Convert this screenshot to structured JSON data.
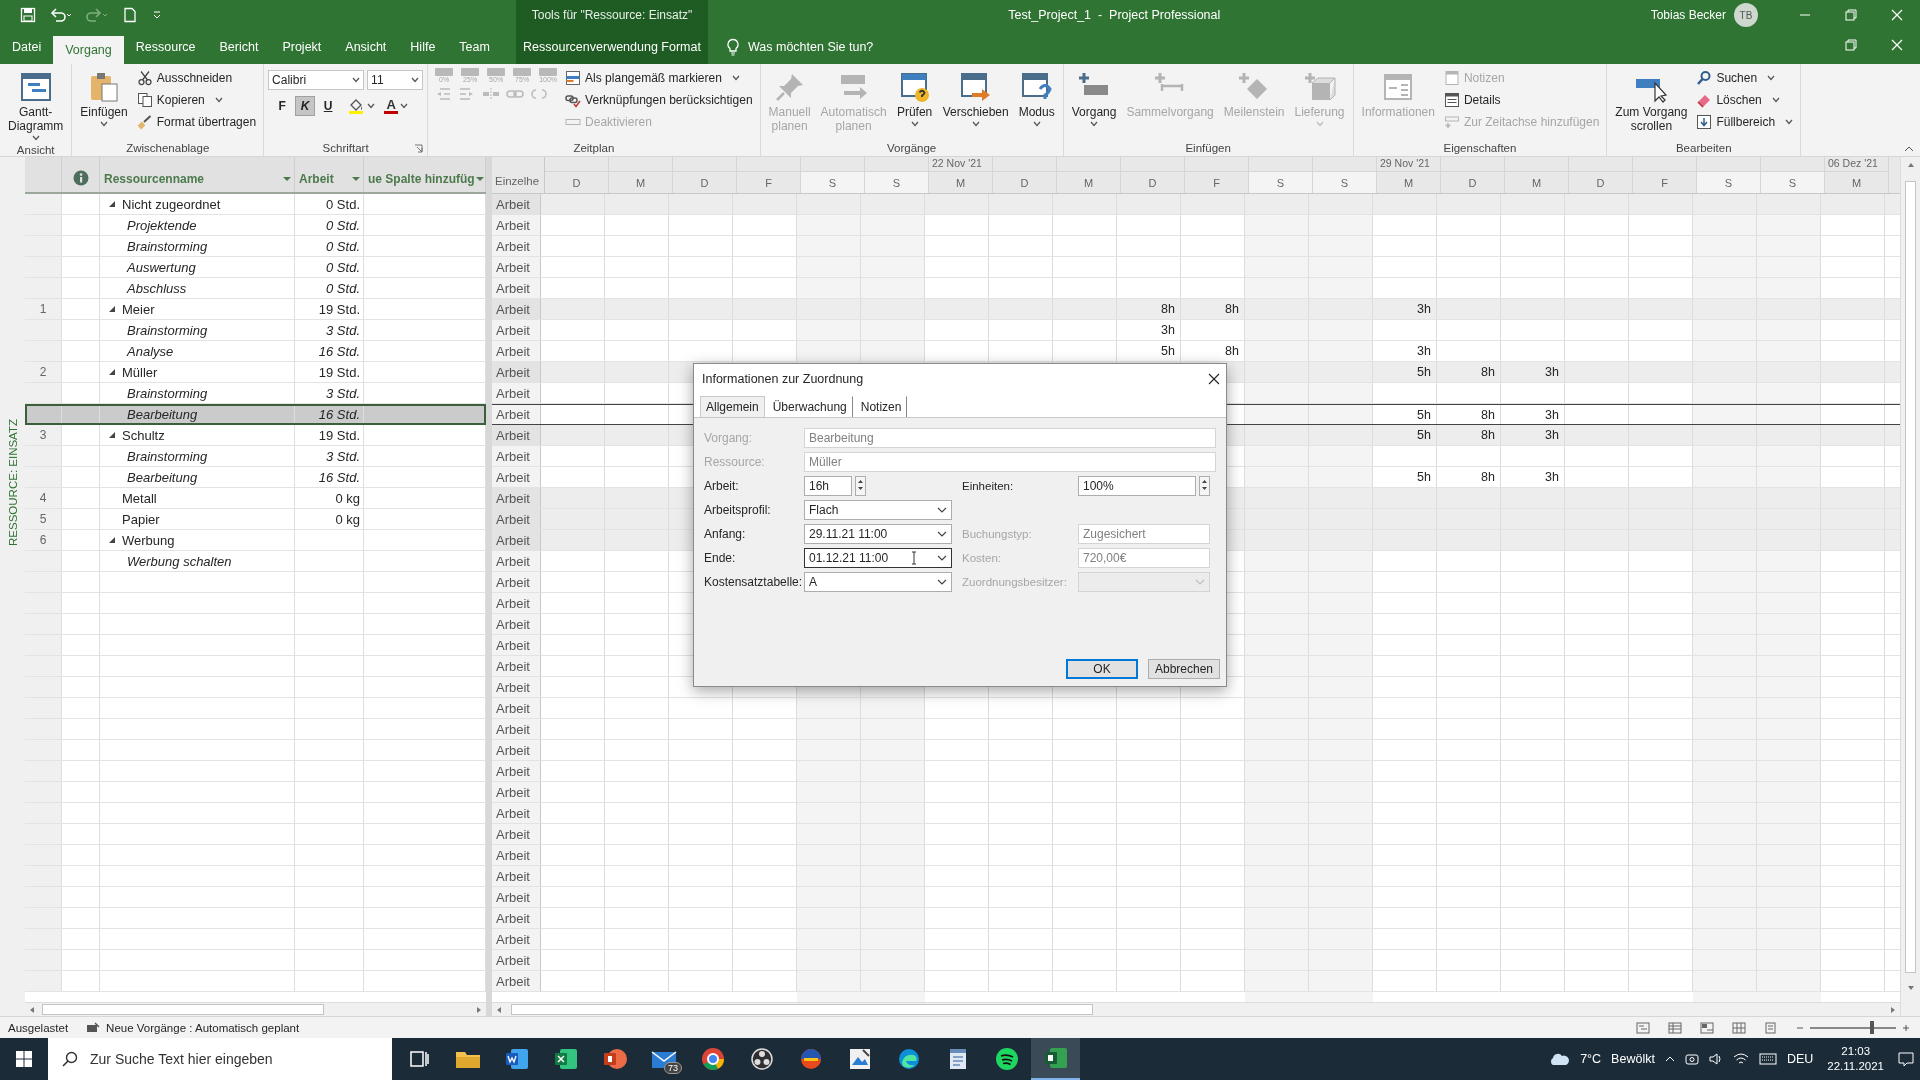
{
  "title_bar": {
    "contextual": "Tools für \"Ressource: Einsatz\"",
    "title": "Test_Project_1  -  Project Professional",
    "user": "Tobias Becker",
    "initials": "TB"
  },
  "tabs": [
    {
      "label": "Datei",
      "selected": false
    },
    {
      "label": "Vorgang",
      "selected": true
    },
    {
      "label": "Ressource",
      "selected": false
    },
    {
      "label": "Bericht",
      "selected": false
    },
    {
      "label": "Projekt",
      "selected": false
    },
    {
      "label": "Ansicht",
      "selected": false
    },
    {
      "label": "Hilfe",
      "selected": false
    },
    {
      "label": "Team",
      "selected": false
    }
  ],
  "contextual_tab": {
    "label": "Ressourcenverwendung Format",
    "selected": false
  },
  "tell_me": {
    "placeholder": "Was möchten Sie tun?"
  },
  "ribbon": [
    {
      "label": "Ansicht",
      "items": [
        {
          "kind": "large",
          "label": "Gantt-\nDiagramm",
          "dropdown": true,
          "disabled": false
        }
      ]
    },
    {
      "label": "Zwischenablage",
      "items": [
        {
          "kind": "large",
          "label": "Einfügen",
          "dropdown": true,
          "disabled": false
        },
        {
          "kind": "small",
          "label": "Ausschneiden",
          "dropdown": false,
          "disabled": false
        },
        {
          "kind": "small",
          "label": "Kopieren",
          "dropdown": true,
          "disabled": false
        },
        {
          "kind": "small",
          "label": "Format übertragen",
          "dropdown": false,
          "disabled": false
        }
      ]
    },
    {
      "label": "Schriftart",
      "items": [
        {
          "kind": "font",
          "font": "Calibri",
          "size": "11",
          "styles": [
            {
              "label": "F",
              "selected": false
            },
            {
              "label": "K",
              "selected": true
            },
            {
              "label": "U",
              "selected": false
            }
          ],
          "font_color": "A"
        }
      ]
    },
    {
      "label": "Zeitplan",
      "items": [
        {
          "kind": "percent",
          "labels": [
            "0%",
            "25%",
            "50%",
            "75%",
            "100%"
          ]
        },
        {
          "kind": "small",
          "label": "Als plangemäß markieren",
          "dropdown": true,
          "disabled": false
        },
        {
          "kind": "small",
          "label": "Verknüpfungen berücksichtigen",
          "dropdown": false,
          "disabled": false
        },
        {
          "kind": "small",
          "label": "Deaktivieren",
          "dropdown": false,
          "disabled": true
        }
      ]
    },
    {
      "label": "Vorgänge",
      "items": [
        {
          "kind": "large",
          "label": "Manuell\nplanen",
          "dropdown": false,
          "disabled": true
        },
        {
          "kind": "large",
          "label": "Automatisch\nplanen",
          "dropdown": false,
          "disabled": true
        },
        {
          "kind": "large",
          "label": "Prüfen",
          "dropdown": true,
          "disabled": false
        },
        {
          "kind": "large",
          "label": "Verschieben",
          "dropdown": true,
          "disabled": false
        },
        {
          "kind": "large",
          "label": "Modus",
          "dropdown": true,
          "disabled": false
        }
      ]
    },
    {
      "label": "Einfügen",
      "items": [
        {
          "kind": "large",
          "label": "Vorgang",
          "dropdown": true,
          "disabled": false
        },
        {
          "kind": "large",
          "label": "Sammelvorgang",
          "dropdown": false,
          "disabled": true
        },
        {
          "kind": "large",
          "label": "Meilenstein",
          "dropdown": false,
          "disabled": true
        },
        {
          "kind": "large",
          "label": "Lieferung",
          "dropdown": true,
          "disabled": true
        }
      ]
    },
    {
      "label": "Eigenschaften",
      "items": [
        {
          "kind": "large",
          "label": "Informationen",
          "dropdown": false,
          "disabled": true
        },
        {
          "kind": "small",
          "label": "Notizen",
          "dropdown": false,
          "disabled": true
        },
        {
          "kind": "small",
          "label": "Details",
          "dropdown": false,
          "disabled": false
        },
        {
          "kind": "small",
          "label": "Zur Zeitachse hinzufügen",
          "dropdown": false,
          "disabled": true
        }
      ]
    },
    {
      "label": "Bearbeiten",
      "items": [
        {
          "kind": "large",
          "label": "Zum Vorgang\nscrollen",
          "dropdown": false,
          "disabled": false
        },
        {
          "kind": "small",
          "label": "Suchen",
          "dropdown": true,
          "disabled": false
        },
        {
          "kind": "small",
          "label": "Löschen",
          "dropdown": true,
          "disabled": false
        },
        {
          "kind": "small",
          "label": "Füllbereich",
          "dropdown": true,
          "disabled": false
        }
      ]
    }
  ],
  "view_label": "RESSOURCE: EINSATZ",
  "table": {
    "columns": [
      "Ressourcenname",
      "Arbeit",
      "ue Spalte hinzufüg"
    ],
    "rows": [
      {
        "name": "Nicht zugeordnet",
        "work": "0 Std.",
        "detail": "Arbeit",
        "expanded": true,
        "selected": false,
        "children": [
          {
            "name": "Projektende",
            "work": "0 Std.",
            "detail": "Arbeit",
            "selected": false
          },
          {
            "name": "Brainstorming",
            "work": "0 Std.",
            "detail": "Arbeit",
            "selected": false
          },
          {
            "name": "Auswertung",
            "work": "0 Std.",
            "detail": "Arbeit",
            "selected": false
          },
          {
            "name": "Abschluss",
            "work": "0 Std.",
            "detail": "Arbeit",
            "selected": false
          }
        ]
      },
      {
        "id": "1",
        "name": "Meier",
        "work": "19 Std.",
        "detail": "Arbeit",
        "expanded": true,
        "selected": false,
        "timephased": {
          "10": "8h",
          "11": "8h",
          "14": "3h"
        },
        "children": [
          {
            "name": "Brainstorming",
            "work": "3 Std.",
            "detail": "Arbeit",
            "selected": false,
            "timephased": {
              "10": "3h"
            }
          },
          {
            "name": "Analyse",
            "work": "16 Std.",
            "detail": "Arbeit",
            "selected": false,
            "timephased": {
              "10": "5h",
              "11": "8h",
              "14": "3h"
            }
          }
        ]
      },
      {
        "id": "2",
        "name": "Müller",
        "work": "19 Std.",
        "detail": "Arbeit",
        "expanded": true,
        "selected": false,
        "timephased": {
          "14": "5h",
          "15": "8h",
          "16": "3h"
        },
        "children": [
          {
            "name": "Brainstorming",
            "work": "3 Std.",
            "detail": "Arbeit",
            "selected": false
          },
          {
            "name": "Bearbeitung",
            "work": "16 Std.",
            "detail": "Arbeit",
            "selected": true,
            "timephased": {
              "14": "5h",
              "15": "8h",
              "16": "3h"
            }
          }
        ]
      },
      {
        "id": "3",
        "name": "Schultz",
        "work": "19 Std.",
        "detail": "Arbeit",
        "expanded": true,
        "selected": false,
        "timephased": {
          "14": "5h",
          "15": "8h",
          "16": "3h"
        },
        "children": [
          {
            "name": "Brainstorming",
            "work": "3 Std.",
            "detail": "Arbeit",
            "selected": false
          },
          {
            "name": "Bearbeitung",
            "work": "16 Std.",
            "detail": "Arbeit",
            "selected": false,
            "timephased": {
              "14": "5h",
              "15": "8h",
              "16": "3h"
            }
          }
        ]
      },
      {
        "id": "4",
        "name": "Metall",
        "work": "0 kg",
        "detail": "Arbeit",
        "selected": false
      },
      {
        "id": "5",
        "name": "Papier",
        "work": "0 kg",
        "detail": "Arbeit",
        "selected": false
      },
      {
        "id": "6",
        "name": "Werbung",
        "detail": "Arbeit",
        "expanded": true,
        "selected": false,
        "children": [
          {
            "name": "Werbung schalten",
            "detail": "Arbeit",
            "selected": false
          }
        ]
      }
    ],
    "empty_rows": [
      {
        "detail": "Arbeit"
      },
      {
        "detail": "Arbeit"
      },
      {
        "detail": "Arbeit"
      },
      {
        "detail": "Arbeit"
      },
      {
        "detail": "Arbeit"
      },
      {
        "detail": "Arbeit"
      },
      {
        "detail": "Arbeit"
      },
      {
        "detail": "Arbeit"
      },
      {
        "detail": "Arbeit"
      },
      {
        "detail": "Arbeit"
      },
      {
        "detail": "Arbeit"
      },
      {
        "detail": "Arbeit"
      },
      {
        "detail": "Arbeit"
      },
      {
        "detail": "Arbeit"
      },
      {
        "detail": "Arbeit"
      },
      {
        "detail": "Arbeit"
      },
      {
        "detail": "Arbeit"
      },
      {
        "detail": "Arbeit"
      },
      {
        "detail": "Arbeit"
      },
      {
        "detail": "Arbeit"
      }
    ]
  },
  "timescale": {
    "detail_header": "Einzelhe",
    "days": [
      {
        "letter": "D",
        "nonworking": false
      },
      {
        "letter": "M",
        "nonworking": false
      },
      {
        "letter": "D",
        "nonworking": false
      },
      {
        "letter": "F",
        "nonworking": false
      },
      {
        "letter": "S",
        "nonworking": true
      },
      {
        "letter": "S",
        "nonworking": true
      },
      {
        "letter": "M",
        "nonworking": false,
        "week": "22 Nov '21"
      },
      {
        "letter": "D",
        "nonworking": false
      },
      {
        "letter": "M",
        "nonworking": false
      },
      {
        "letter": "D",
        "nonworking": false
      },
      {
        "letter": "F",
        "nonworking": false
      },
      {
        "letter": "S",
        "nonworking": true
      },
      {
        "letter": "S",
        "nonworking": true
      },
      {
        "letter": "M",
        "nonworking": false,
        "week": "29 Nov '21"
      },
      {
        "letter": "D",
        "nonworking": false
      },
      {
        "letter": "M",
        "nonworking": false
      },
      {
        "letter": "D",
        "nonworking": false
      },
      {
        "letter": "F",
        "nonworking": false
      },
      {
        "letter": "S",
        "nonworking": true
      },
      {
        "letter": "S",
        "nonworking": true
      },
      {
        "letter": "M",
        "nonworking": false,
        "week": "06 Dez '21"
      }
    ]
  },
  "dialog": {
    "title": "Informationen zur Zuordnung",
    "tabs": [
      {
        "label": "Allgemein",
        "selected": true
      },
      {
        "label": "Überwachung",
        "selected": false
      },
      {
        "label": "Notizen",
        "selected": false
      }
    ],
    "rows": [
      [
        {
          "label": "Vorgang:",
          "value": "Bearbeitung",
          "kind": "text",
          "disabled": true,
          "full": true
        }
      ],
      [
        {
          "label": "Ressource:",
          "value": "Müller",
          "kind": "text",
          "disabled": true,
          "full": true
        }
      ],
      [
        {
          "label": "Arbeit:",
          "value": "16h",
          "kind": "spin",
          "disabled": false
        },
        {
          "label": "Einheiten:",
          "value": "100%",
          "kind": "spin",
          "disabled": false
        }
      ],
      [
        {
          "label": "Arbeitsprofil:",
          "value": "Flach",
          "kind": "dropdown",
          "disabled": false
        }
      ],
      [
        {
          "label": "Anfang:",
          "value": "29.11.21 11:00",
          "kind": "dropdown",
          "disabled": false
        },
        {
          "label": "Buchungstyp:",
          "value": "Zugesichert",
          "kind": "text",
          "disabled": true
        }
      ],
      [
        {
          "label": "Ende:",
          "value": "01.12.21 11:00",
          "kind": "dropdown",
          "disabled": false,
          "focused": true
        },
        {
          "label": "Kosten:",
          "value": "720,00€",
          "kind": "text",
          "disabled": true
        }
      ],
      [
        {
          "label": "Kostensatztabelle:",
          "value": "A",
          "kind": "dropdown",
          "disabled": false
        },
        {
          "label": "Zuordnungsbesitzer:",
          "kind": "dropdown",
          "disabled": true
        }
      ]
    ],
    "buttons": [
      {
        "label": "OK",
        "default": true
      },
      {
        "label": "Abbrechen",
        "default": false
      }
    ]
  },
  "status_bar": {
    "mode": "Ausgelastet",
    "new_tasks": "Neue Vorgänge : Automatisch geplant",
    "zoom": {
      "level": 0.72
    }
  },
  "taskbar": {
    "search": {
      "placeholder": "Zur Suche Text hier eingeben"
    },
    "apps": [
      {
        "kind": "taskview",
        "active": false
      },
      {
        "kind": "folder",
        "active": false
      },
      {
        "kind": "word",
        "active": false
      },
      {
        "kind": "excel",
        "active": false
      },
      {
        "kind": "powerpoint",
        "active": false
      },
      {
        "kind": "mail",
        "active": false,
        "badge": "73"
      },
      {
        "kind": "chrome",
        "active": false
      },
      {
        "kind": "obs",
        "active": false
      },
      {
        "kind": "circle",
        "active": false
      },
      {
        "kind": "image",
        "active": false
      },
      {
        "kind": "edge",
        "active": false
      },
      {
        "kind": "notepad",
        "active": false
      },
      {
        "kind": "spotify",
        "active": false
      },
      {
        "kind": "project",
        "active": true
      }
    ],
    "weather": {
      "temp": "7°C",
      "text": "Bewölkt"
    },
    "language": "DEU",
    "time": "21:03",
    "date": "22.11.2021"
  }
}
